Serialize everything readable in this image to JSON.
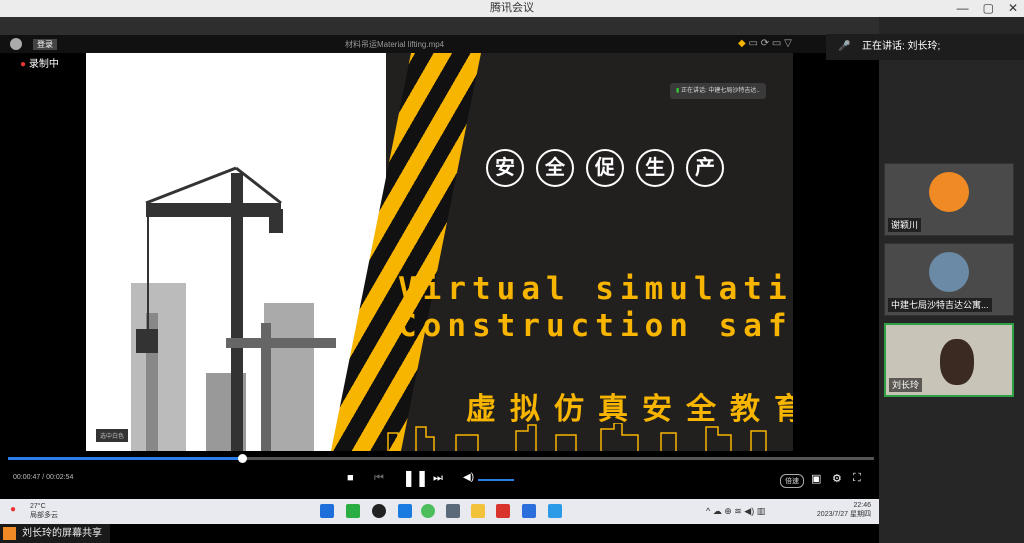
{
  "window": {
    "title": "腾讯会议",
    "min": "—",
    "max": "▢",
    "close": "✕"
  },
  "player": {
    "login": "登录",
    "filename": "材料吊运Material lifting.mp4",
    "recording": "录制中"
  },
  "video": {
    "circles": [
      "安",
      "全",
      "促",
      "生",
      "产"
    ],
    "line1": "Virtual simulation",
    "line2": "Construction safety",
    "cn_title": "虚拟仿真安全教育",
    "inner_speaking": "正在讲话: 中建七局沙特吉达..",
    "watermark": "选中白色"
  },
  "controls": {
    "time": "00:00:47 / 00:02:54",
    "progress": 0.27,
    "speed": "倍速"
  },
  "taskbar": {
    "temp": "27°C",
    "weather": "局部多云",
    "time": "22:46",
    "date": "2023/7/27 星期四"
  },
  "share_label": "刘长玲的屏幕共享",
  "speaking_now": "正在讲话: 刘长玲;",
  "participants": [
    {
      "name": "谢颖川"
    },
    {
      "name": "中建七局沙特吉达公寓..."
    },
    {
      "name": "刘长玲"
    }
  ],
  "colors": {
    "accent": "#f7b500",
    "progress": "#2b7de9",
    "active_tile": "#2ea043"
  }
}
